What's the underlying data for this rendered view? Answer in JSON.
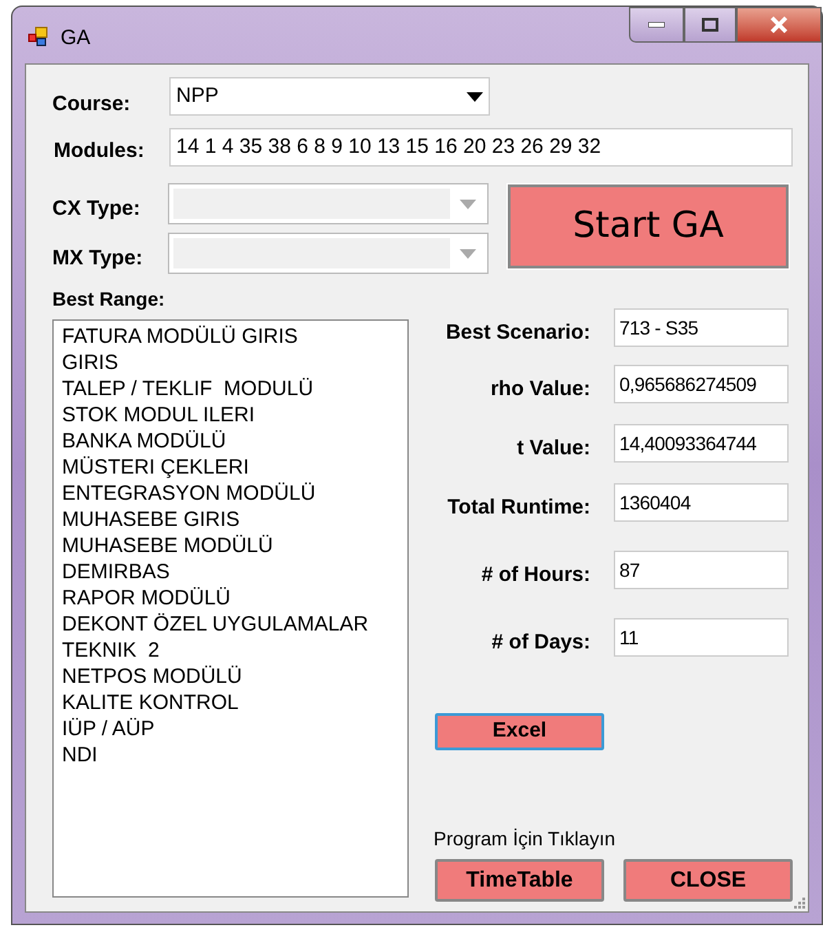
{
  "window": {
    "title": "GA"
  },
  "course": {
    "label": "Course:",
    "value": "NPP"
  },
  "modules": {
    "label": "Modules:",
    "value": "14 1 4 35 38 6 8 9 10 13 15 16 20 23 26 29 32"
  },
  "selectors": [
    {
      "label": "CX Type:",
      "disabled": true
    },
    {
      "label": "MX Type:",
      "disabled": true
    }
  ],
  "start_button": "Start GA",
  "best_range": {
    "label": "Best Range:",
    "items": [
      "FATURA MODÜLÜ GIRIS",
      "GIRIS",
      "TALEP / TEKLIF  MODULÜ",
      "STOK MODUL ILERI",
      "BANKA MODÜLÜ",
      "MÜSTERI ÇEKLERI",
      "ENTEGRASYON MODÜLÜ",
      "MUHASEBE GIRIS",
      "MUHASEBE MODÜLÜ",
      "DEMIRBAS",
      "RAPOR MODÜLÜ",
      "DEKONT ÖZEL UYGULAMALAR",
      "TEKNIK  2",
      "NETPOS MODÜLÜ",
      "KALITE KONTROL",
      "IÜP / AÜP",
      "NDI"
    ]
  },
  "results": [
    {
      "label": "Best Scenario:",
      "value": "713 - S35"
    },
    {
      "label": "rho Value:",
      "value": "0,965686274509"
    },
    {
      "label": "t Value:",
      "value": "14,40093364744"
    },
    {
      "label": "Total Runtime:",
      "value": "1360404"
    },
    {
      "label": "# of Hours:",
      "value": "87"
    },
    {
      "label": "# of Days:",
      "value": "11"
    }
  ],
  "excel_button": {
    "label": "Excel",
    "focused": true
  },
  "program_hint": "Program İçin Tıklayın",
  "buttons": [
    {
      "label": "TimeTable",
      "focused": false
    },
    {
      "label": "CLOSE",
      "focused": false
    }
  ]
}
